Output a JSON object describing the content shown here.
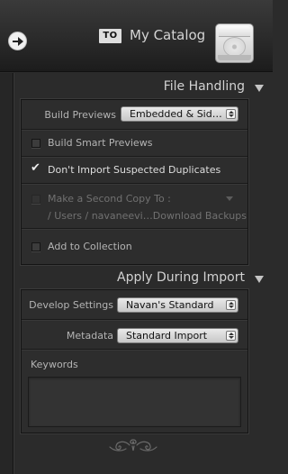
{
  "header": {
    "to_badge": "TO",
    "catalog_name": "My Catalog",
    "icons": {
      "nav": "arrow-right-icon",
      "drive": "hard-drive-icon"
    }
  },
  "file_handling": {
    "title": "File Handling",
    "build_previews": {
      "label": "Build Previews",
      "value": "Embedded & Sid…"
    },
    "build_smart_previews": {
      "label": "Build Smart Previews",
      "checked": false
    },
    "dont_import_duplicates": {
      "label": "Don't Import Suspected Duplicates",
      "checked": true
    },
    "second_copy": {
      "label": "Make a Second Copy To :",
      "path": "/ Users / navaneevi…Download Backups",
      "checked": false,
      "enabled": false
    },
    "add_to_collection": {
      "label": "Add to Collection",
      "checked": false
    }
  },
  "apply_during_import": {
    "title": "Apply During Import",
    "develop_settings": {
      "label": "Develop Settings",
      "value": "Navan's Standard"
    },
    "metadata": {
      "label": "Metadata",
      "value": "Standard Import"
    },
    "keywords": {
      "label": "Keywords",
      "value": ""
    }
  },
  "colors": {
    "background": "#2b2b2b",
    "panel": "#2d2d2d",
    "text": "#b4b4b4",
    "highlight": "#dedede"
  }
}
